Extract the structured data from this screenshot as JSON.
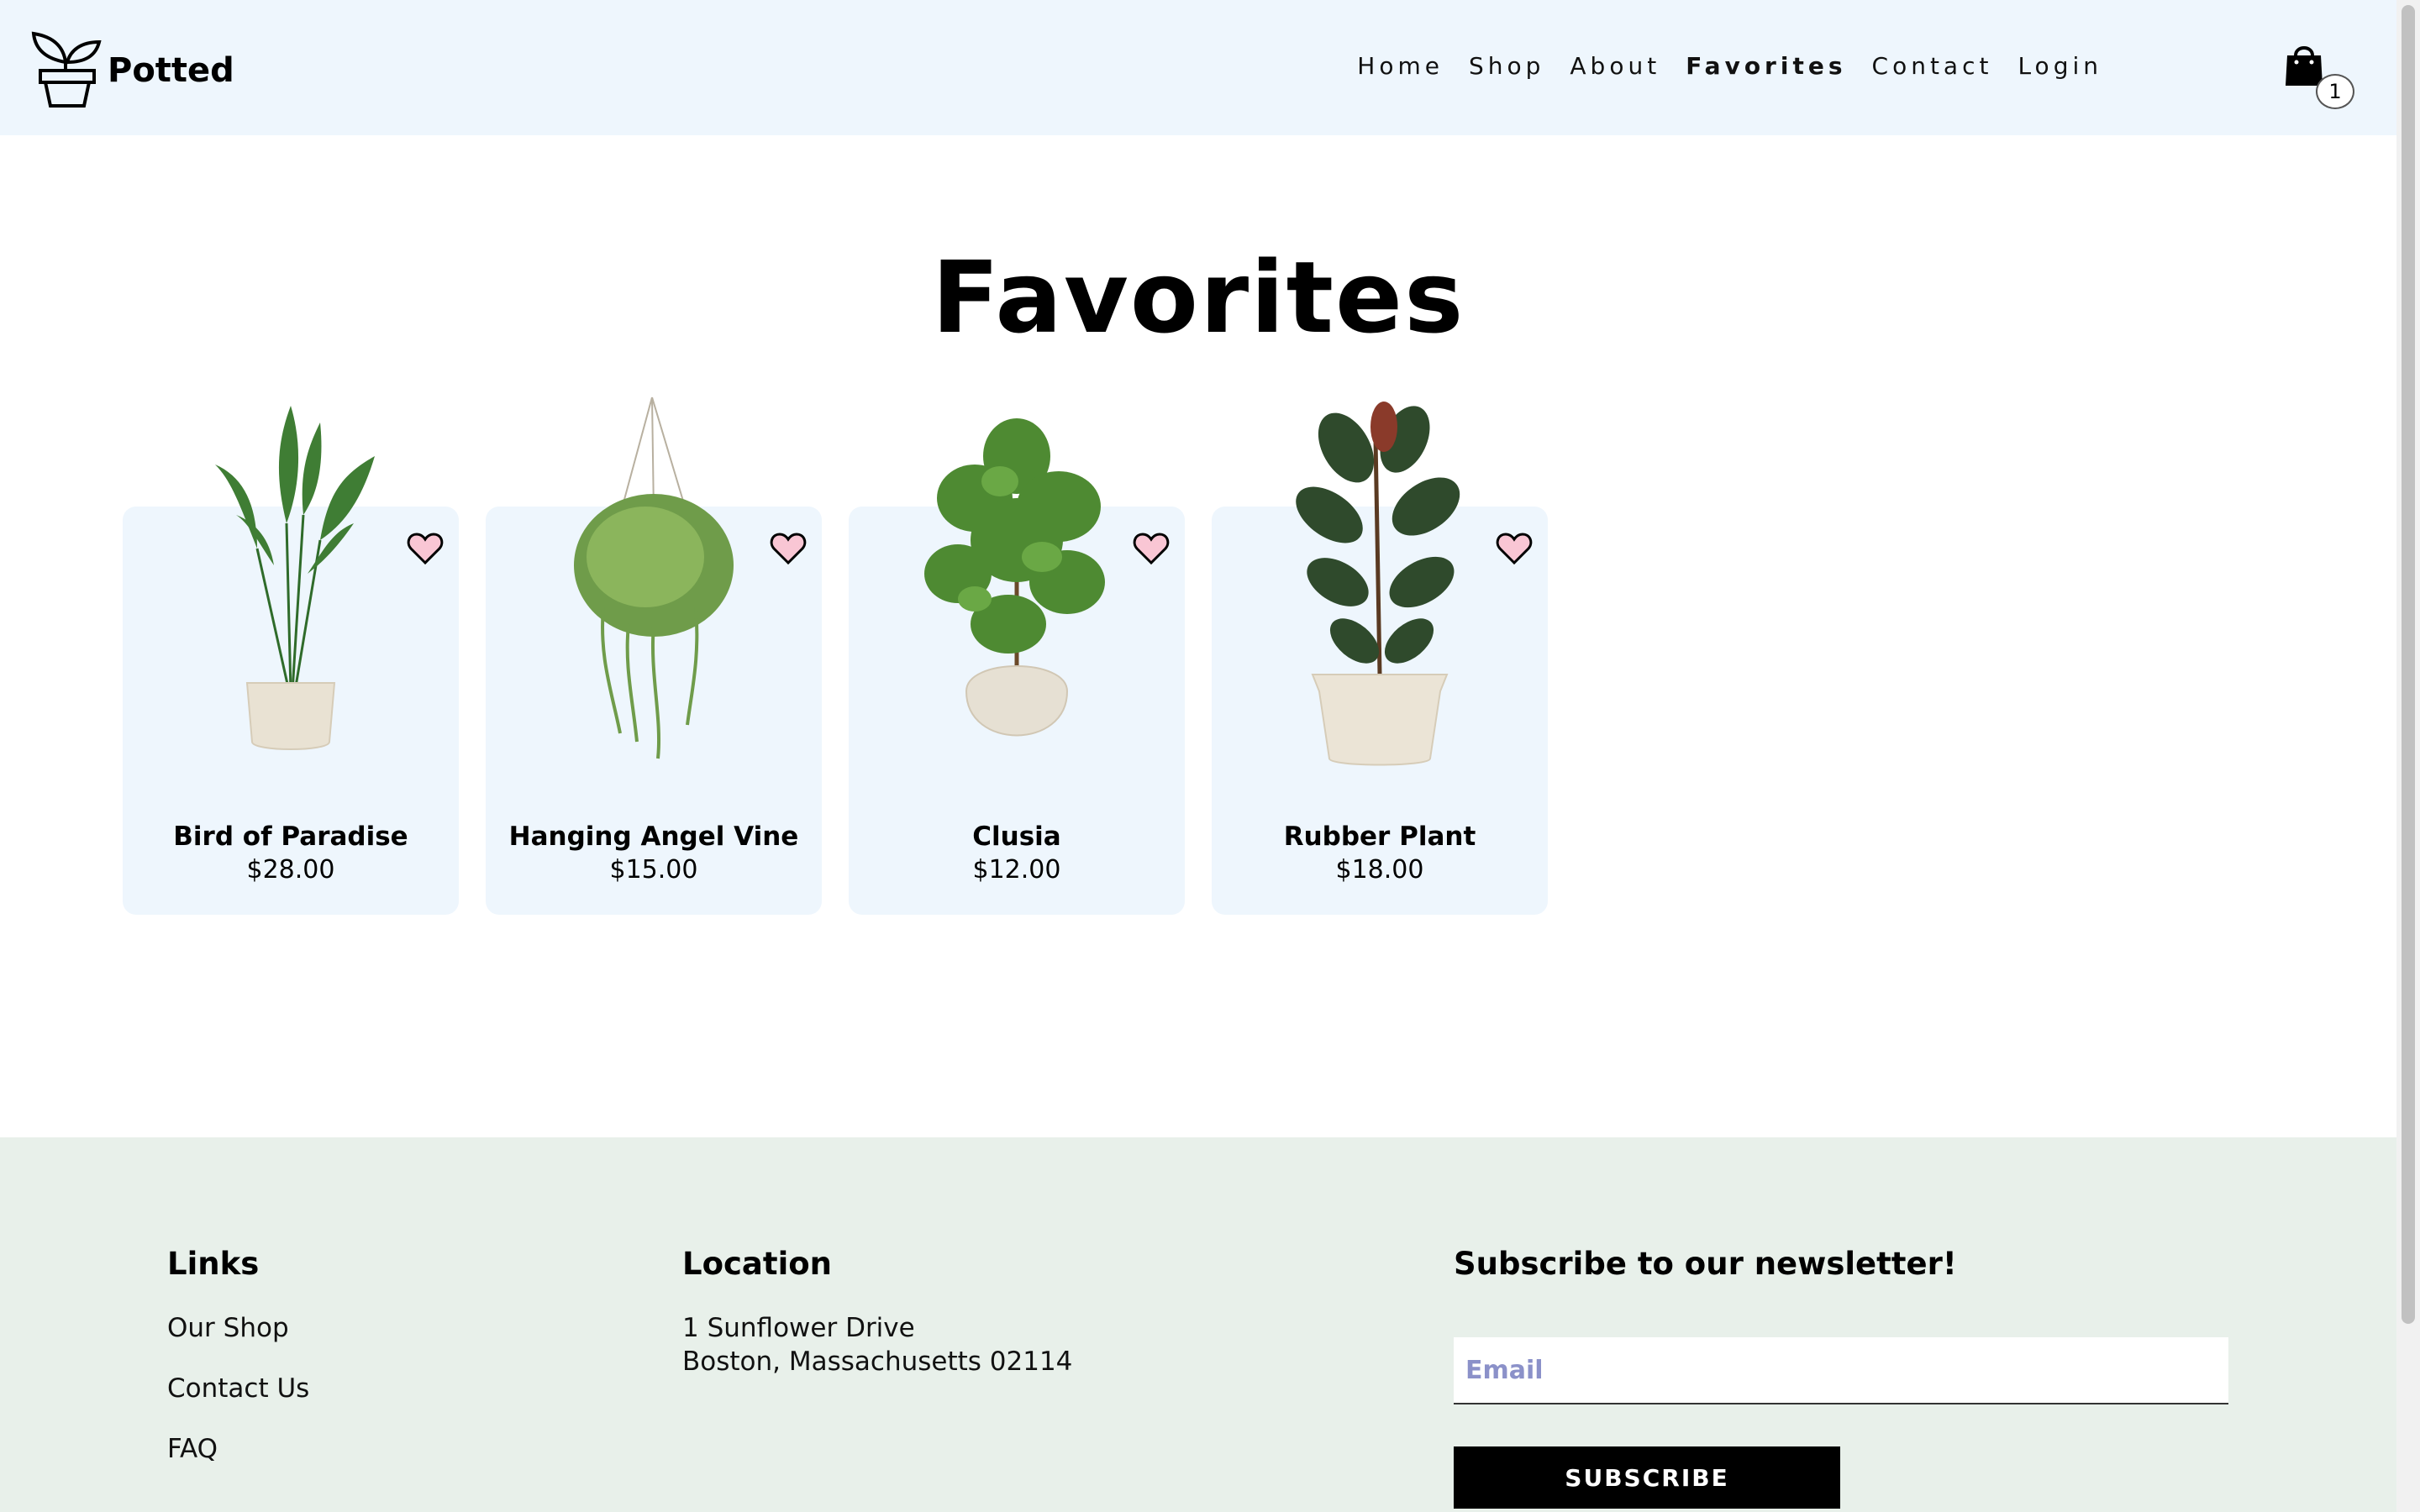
{
  "brand": {
    "name": "Potted",
    "icon": "plant-pot-logo-icon"
  },
  "nav": {
    "items": [
      {
        "label": "Home",
        "active": false
      },
      {
        "label": "Shop",
        "active": false
      },
      {
        "label": "About",
        "active": false
      },
      {
        "label": "Favorites",
        "active": true
      },
      {
        "label": "Contact",
        "active": false
      },
      {
        "label": "Login",
        "active": false
      }
    ],
    "cart": {
      "icon": "shopping-bag-icon",
      "count": "1"
    }
  },
  "page": {
    "title": "Favorites"
  },
  "products": [
    {
      "name": "Bird of Paradise",
      "price": "$28.00",
      "favorite_icon": "heart-icon"
    },
    {
      "name": "Hanging Angel Vine",
      "price": "$15.00",
      "favorite_icon": "heart-icon"
    },
    {
      "name": "Clusia",
      "price": "$12.00",
      "favorite_icon": "heart-icon"
    },
    {
      "name": "Rubber Plant",
      "price": "$18.00",
      "favorite_icon": "heart-icon"
    }
  ],
  "footer": {
    "links": {
      "heading": "Links",
      "items": [
        "Our Shop",
        "Contact Us",
        "FAQ"
      ]
    },
    "location": {
      "heading": "Location",
      "line1": "1 Sunflower Drive",
      "line2": "Boston, Massachusetts 02114"
    },
    "newsletter": {
      "heading": "Subscribe to our newsletter!",
      "email_placeholder": "Email",
      "button_label": "SUBSCRIBE"
    }
  },
  "colors": {
    "header_bg": "#eef6fd",
    "card_bg": "#eef6fd",
    "footer_bg": "#e8f0ea",
    "heart_fill": "#f9c6d4",
    "button_bg": "#000000"
  }
}
